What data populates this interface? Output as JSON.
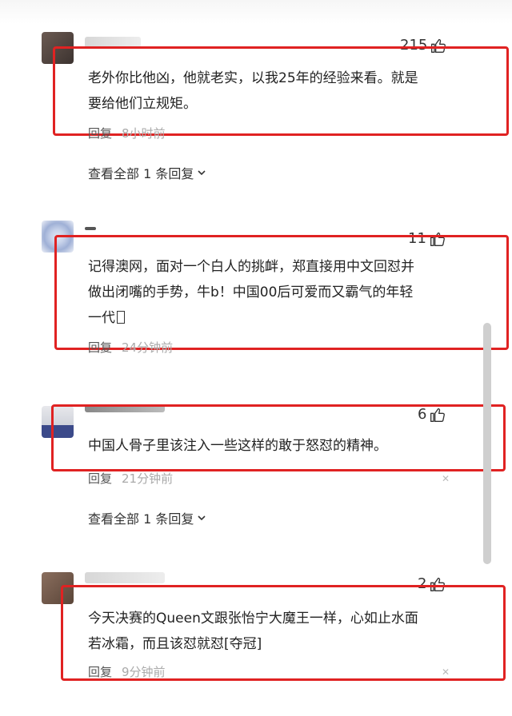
{
  "comments": [
    {
      "likes": "215",
      "text_line1": "老外你比他凶，他就老实，以我25年的经验来看。就是",
      "text_line2": "要给他们立规矩。",
      "reply_label": "回复",
      "time": "8小时前",
      "view_all": "查看全部 1 条回复"
    },
    {
      "likes": "11",
      "text_line1": "记得澳网，面对一个白人的挑衅，郑直接用中文回怼并",
      "text_line2": "做出闭嘴的手势，牛b！中国00后可爱而又霸气的年轻",
      "text_line3": "一代",
      "reply_label": "回复",
      "time": "24分钟前"
    },
    {
      "likes": "6",
      "text_line1": "中国人骨子里该注入一些这样的敢于怒怼的精神。",
      "reply_label": "回复",
      "time": "21分钟前",
      "view_all": "查看全部 1 条回复"
    },
    {
      "likes": "2",
      "text_line1": "今天决赛的Queen文跟张怡宁大魔王一样，心如止水面",
      "text_line2": "若冰霜，而且该怼就怼[夺冠]",
      "reply_label": "回复",
      "time": "9分钟前"
    }
  ],
  "colors": {
    "highlight_box": "#e02222",
    "meta_text": "#555555",
    "time_text": "#aaaaaa"
  },
  "icons": [
    "thumb-up-icon",
    "chevron-down-icon",
    "close-icon"
  ]
}
